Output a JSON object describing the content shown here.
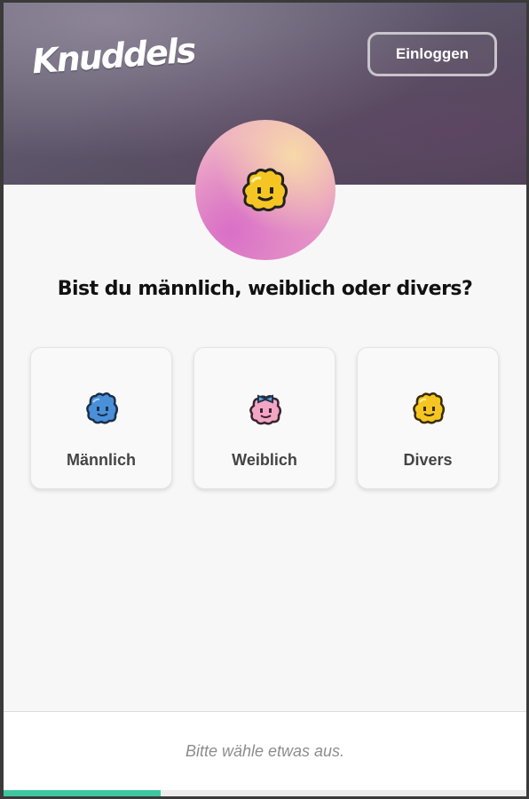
{
  "header": {
    "logo_text": "Knuddels",
    "login_label": "Einloggen"
  },
  "avatar": {
    "icon": "yellow-blob-icon"
  },
  "question": "Bist du männlich, weiblich oder divers?",
  "options": [
    {
      "label": "Männlich",
      "icon": "blue-blob-icon",
      "color": "#4a90d9"
    },
    {
      "label": "Weiblich",
      "icon": "pink-blob-bow-icon",
      "color": "#f2a6c4"
    },
    {
      "label": "Divers",
      "icon": "yellow-blob-icon",
      "color": "#f5c623"
    }
  ],
  "footer": {
    "hint": "Bitte wähle etwas aus.",
    "progress": 0.3
  },
  "colors": {
    "accent": "#3fc6a0",
    "header_bg": "#5c5468"
  }
}
